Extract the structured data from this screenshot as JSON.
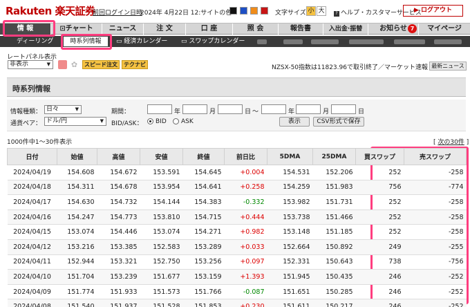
{
  "top": {
    "logo": "Rakuten 楽天証券",
    "login_link": "前回ログイン日時",
    "login_date": "2024年 4月22日 12:",
    "site_color_label": "サイトの色",
    "font_size_label": "文字サイズ",
    "font_small": "小",
    "font_large": "大",
    "help": "ヘルプ・カスタマーサービス",
    "logout": "ログアウト",
    "colors": {
      "black": "#111111",
      "blue": "#1d4fc4",
      "orange": "#f08c1a",
      "red": "#c81515"
    }
  },
  "mainnav": [
    {
      "label": "情 報"
    },
    {
      "label": "チャート"
    },
    {
      "label": "ニュース"
    },
    {
      "label": "注 文"
    },
    {
      "label": "口 座"
    },
    {
      "label": "照 会"
    },
    {
      "label": "報告書"
    },
    {
      "label": "入出金·振替"
    },
    {
      "label": "お知らせ",
      "badge": "7"
    },
    {
      "label": "マイページ"
    }
  ],
  "subnav": [
    "ディーリング",
    "時系列情報",
    "経済カレンダー",
    "スワップカレンダー"
  ],
  "panel": {
    "label": "レートパネル表示",
    "select": "非表示",
    "speed_order": "スピード注文",
    "technavi": "テクナビ",
    "market_text": "NZSX-50指数は11823.96で取引終了／マーケット速報",
    "news_button": "最新ニュース"
  },
  "section_title": "時系列情報",
  "form": {
    "info_type_label": "情報種類：",
    "info_type": "日々",
    "pair_label": "通貨ペア：",
    "pair": "ドル/円",
    "period_label": "期間：",
    "year": "年",
    "month": "月",
    "day": "日",
    "tilde": "〜",
    "bidask_label": "BID/ASK：",
    "bid": "BID",
    "ask": "ASK",
    "show_button": "表示",
    "csv_button": "CSV形式で保存"
  },
  "count_text": "1000件中1〜30件表示",
  "next_prefix": "[ ",
  "next_link": "次の30件",
  "next_suffix": " ]",
  "table": {
    "headers": [
      "日付",
      "始値",
      "高値",
      "安値",
      "終値",
      "前日比",
      "5DMA",
      "25DMA",
      "買スワップ",
      "売スワップ"
    ],
    "rows": [
      [
        "2024/04/19",
        "154.608",
        "154.672",
        "153.591",
        "154.645",
        "+0.004",
        "154.531",
        "152.206",
        "252",
        "-258"
      ],
      [
        "2024/04/18",
        "154.311",
        "154.678",
        "153.954",
        "154.641",
        "+0.258",
        "154.259",
        "151.983",
        "756",
        "-774"
      ],
      [
        "2024/04/17",
        "154.630",
        "154.732",
        "154.144",
        "154.383",
        "-0.332",
        "153.982",
        "151.731",
        "252",
        "-258"
      ],
      [
        "2024/04/16",
        "154.247",
        "154.773",
        "153.810",
        "154.715",
        "+0.444",
        "153.738",
        "151.466",
        "252",
        "-258"
      ],
      [
        "2024/04/15",
        "153.074",
        "154.446",
        "153.074",
        "154.271",
        "+0.982",
        "153.148",
        "151.185",
        "252",
        "-258"
      ],
      [
        "2024/04/12",
        "153.216",
        "153.385",
        "152.583",
        "153.289",
        "+0.033",
        "152.664",
        "150.892",
        "249",
        "-255"
      ],
      [
        "2024/04/11",
        "152.944",
        "153.321",
        "152.750",
        "153.256",
        "+0.097",
        "152.331",
        "150.643",
        "738",
        "-756"
      ],
      [
        "2024/04/10",
        "151.704",
        "153.239",
        "151.677",
        "153.159",
        "+1.393",
        "151.945",
        "150.435",
        "246",
        "-252"
      ],
      [
        "2024/04/09",
        "151.774",
        "151.933",
        "151.573",
        "151.766",
        "-0.087",
        "151.651",
        "150.285",
        "246",
        "-252"
      ],
      [
        "2024/04/08",
        "151.540",
        "151.937",
        "151.528",
        "151.853",
        "+0.230",
        "151.611",
        "150.217",
        "246",
        "-252"
      ]
    ]
  }
}
